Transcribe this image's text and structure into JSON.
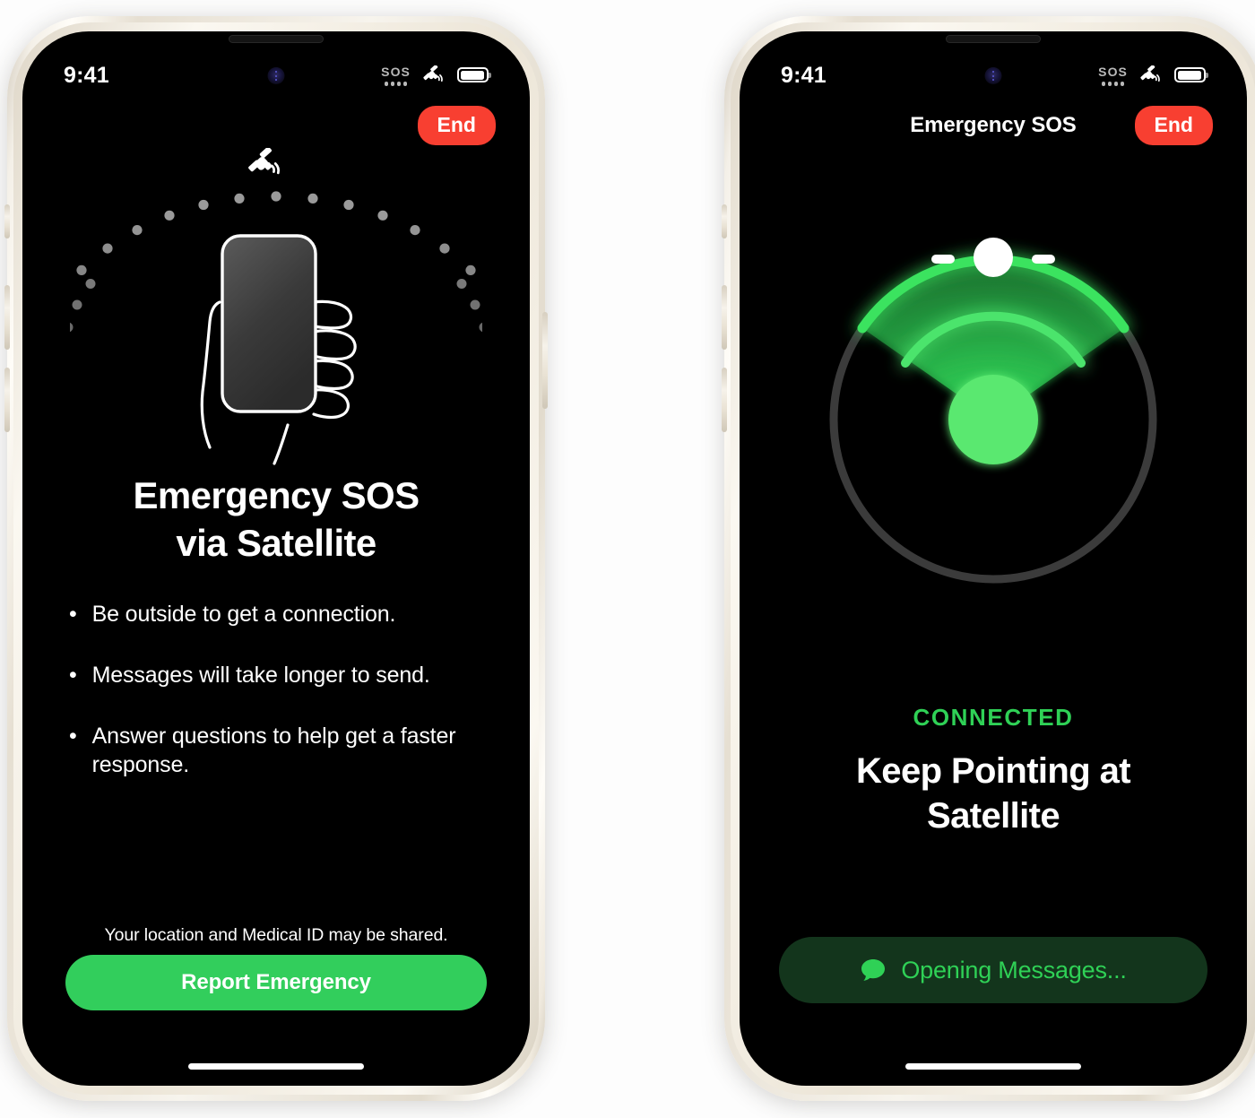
{
  "brand": {
    "green": "#32ce5c",
    "bright_green": "#5ae870",
    "red": "#f83f31",
    "dark_green": "#13351c",
    "screen_bg": "#000000",
    "frame": "#ece5d7"
  },
  "phones": [
    {
      "id": "left",
      "status_bar": {
        "time": "9:41",
        "sos_label": "SOS",
        "satellite_icon": "satellite-icon",
        "battery_icon": "battery-icon"
      },
      "nav": {
        "title": "",
        "end_label": "End"
      },
      "illustration": {
        "name": "hand-holding-phone-satellite-arc",
        "satellite_icon": "satellite-icon",
        "arc_dots": 34
      },
      "headline_line1": "Emergency SOS",
      "headline_line2": "via Satellite",
      "bullets": [
        "Be outside to get a connection.",
        "Messages will take longer to send.",
        "Answer questions to help get a faster response."
      ],
      "bullet_marker": "•",
      "legal": "Your location and Medical ID may be shared.",
      "cta_label": "Report Emergency"
    },
    {
      "id": "right",
      "status_bar": {
        "time": "9:41",
        "sos_label": "SOS",
        "satellite_icon": "satellite-icon",
        "battery_icon": "battery-icon"
      },
      "nav": {
        "title": "Emergency SOS",
        "end_label": "End"
      },
      "radar": {
        "name": "satellite-pointing-radar",
        "outer_ring_color": "#3a3a3a",
        "cone_color": "#2fd156",
        "center_dot_color": "#5ae870",
        "satellite_marker_color": "#ffffff",
        "cone_half_angle_deg": 55
      },
      "status_label": "CONNECTED",
      "headline_line1": "Keep Pointing at",
      "headline_line2": "Satellite",
      "cta_label": "Opening Messages...",
      "cta_icon": "message-bubble-icon"
    }
  ]
}
